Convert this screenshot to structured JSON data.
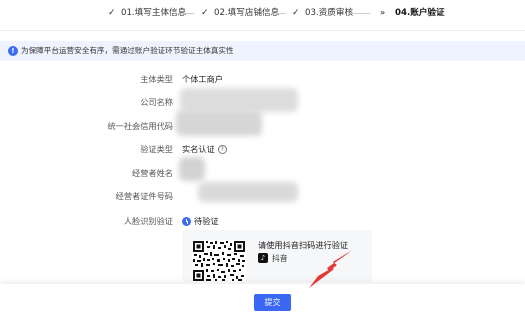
{
  "stepper": {
    "steps": [
      {
        "label": "01.填写主体信息",
        "state": "done"
      },
      {
        "label": "02.填写店铺信息",
        "state": "done"
      },
      {
        "label": "03.资质审核",
        "state": "done"
      },
      {
        "label": "04.账户验证",
        "state": "active"
      }
    ]
  },
  "notice": {
    "icon": "info-icon",
    "text": "为保障平台运营安全有序，需通过账户验证环节验证主体真实性"
  },
  "form": {
    "entity_type": {
      "label": "主体类型",
      "value": "个体工商户"
    },
    "company_name": {
      "label": "公司名称",
      "value": ""
    },
    "credit_code": {
      "label": "统一社会信用代码",
      "value": ""
    },
    "verify_type": {
      "label": "验证类型",
      "value": "实名认证",
      "help_icon": "help-circle-icon"
    },
    "operator_name": {
      "label": "经营者姓名",
      "value": ""
    },
    "operator_id": {
      "label": "经营者证件号码",
      "value": ""
    },
    "face_verify": {
      "label": "人脸识别验证",
      "status": "待验证",
      "status_color": "#3b6bf0"
    }
  },
  "qr_card": {
    "title": "请使用抖音扫码进行验证",
    "app_label": "抖音",
    "app_icon": "tiktok-icon"
  },
  "footer": {
    "submit_label": "提交",
    "accent": "#3a68f2"
  },
  "annotation": {
    "color": "#e53935"
  }
}
